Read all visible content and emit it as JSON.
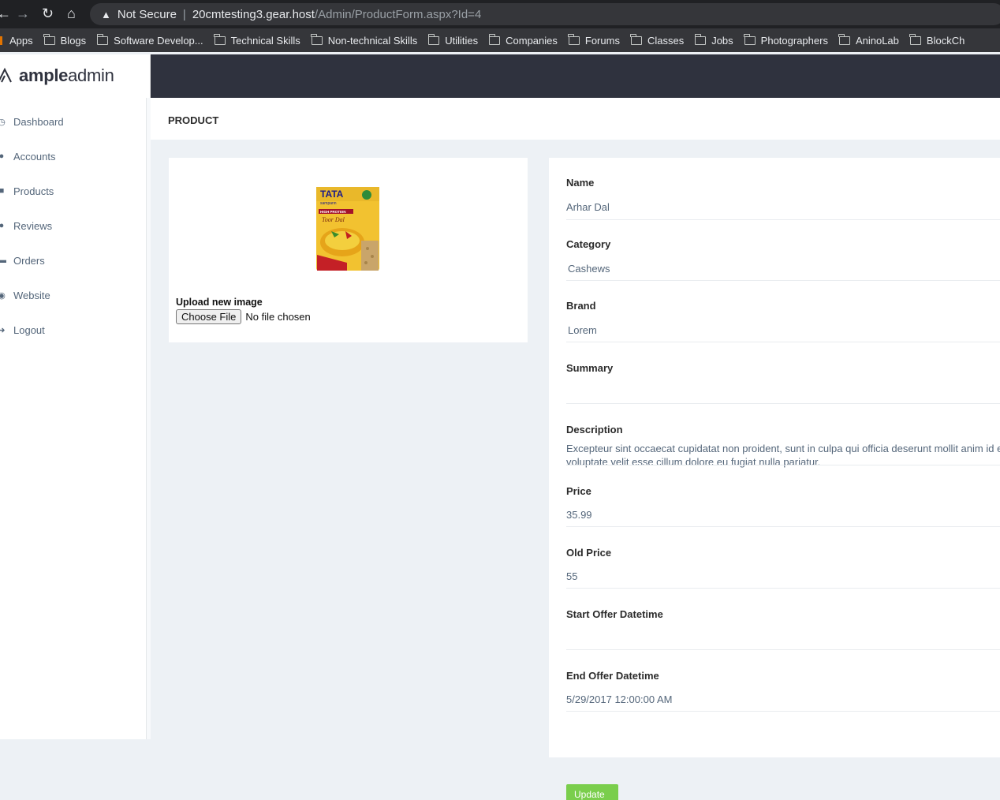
{
  "browser": {
    "not_secure": "Not Secure",
    "url_host": "20cmtesting3.gear.host",
    "url_path": "/Admin/ProductForm.aspx?Id=4",
    "bookmarks": [
      "Apps",
      "Blogs",
      "Software Develop...",
      "Technical Skills",
      "Non-technical Skills",
      "Utilities",
      "Companies",
      "Forums",
      "Classes",
      "Jobs",
      "Photographers",
      "AninoLab",
      "BlockCh"
    ]
  },
  "app": {
    "logo_bold": "ample",
    "logo_light": "admin"
  },
  "sidebar": {
    "items": [
      {
        "label": "Dashboard",
        "icon": "clock-icon"
      },
      {
        "label": "Accounts",
        "icon": "users-icon"
      },
      {
        "label": "Products",
        "icon": "shopping-bag-icon"
      },
      {
        "label": "Reviews",
        "icon": "comments-icon"
      },
      {
        "label": "Orders",
        "icon": "cart-icon"
      },
      {
        "label": "Website",
        "icon": "globe-icon"
      },
      {
        "label": "Logout",
        "icon": "sign-out-icon"
      }
    ]
  },
  "page": {
    "title": "PRODUCT"
  },
  "image_card": {
    "upload_label": "Upload new image",
    "choose_file": "Choose File",
    "no_file": "No file chosen",
    "package_brand": "TATA",
    "package_sub": "sampann",
    "package_tagline": "HIGH PROTEIN",
    "package_product": "Toor Dal"
  },
  "form": {
    "name_label": "Name",
    "name_value": "Arhar Dal",
    "category_label": "Category",
    "category_value": "Cashews",
    "brand_label": "Brand",
    "brand_value": "Lorem",
    "summary_label": "Summary",
    "summary_value": "",
    "description_label": "Description",
    "description_value": "Excepteur sint occaecat cupidatat non proident, sunt in culpa qui officia deserunt mollit anim id e voluptate velit esse cillum dolore eu fugiat nulla pariatur.",
    "price_label": "Price",
    "price_value": "35.99",
    "old_price_label": "Old Price",
    "old_price_value": "55",
    "start_offer_label": "Start Offer Datetime",
    "start_offer_value": "",
    "end_offer_label": "End Offer Datetime",
    "end_offer_value": "5/29/2017 12:00:00 AM",
    "update_label": "Update"
  },
  "colors": {
    "topbar": "#2f323e",
    "accent_green": "#7ace4c",
    "text_muted": "#54667a"
  }
}
